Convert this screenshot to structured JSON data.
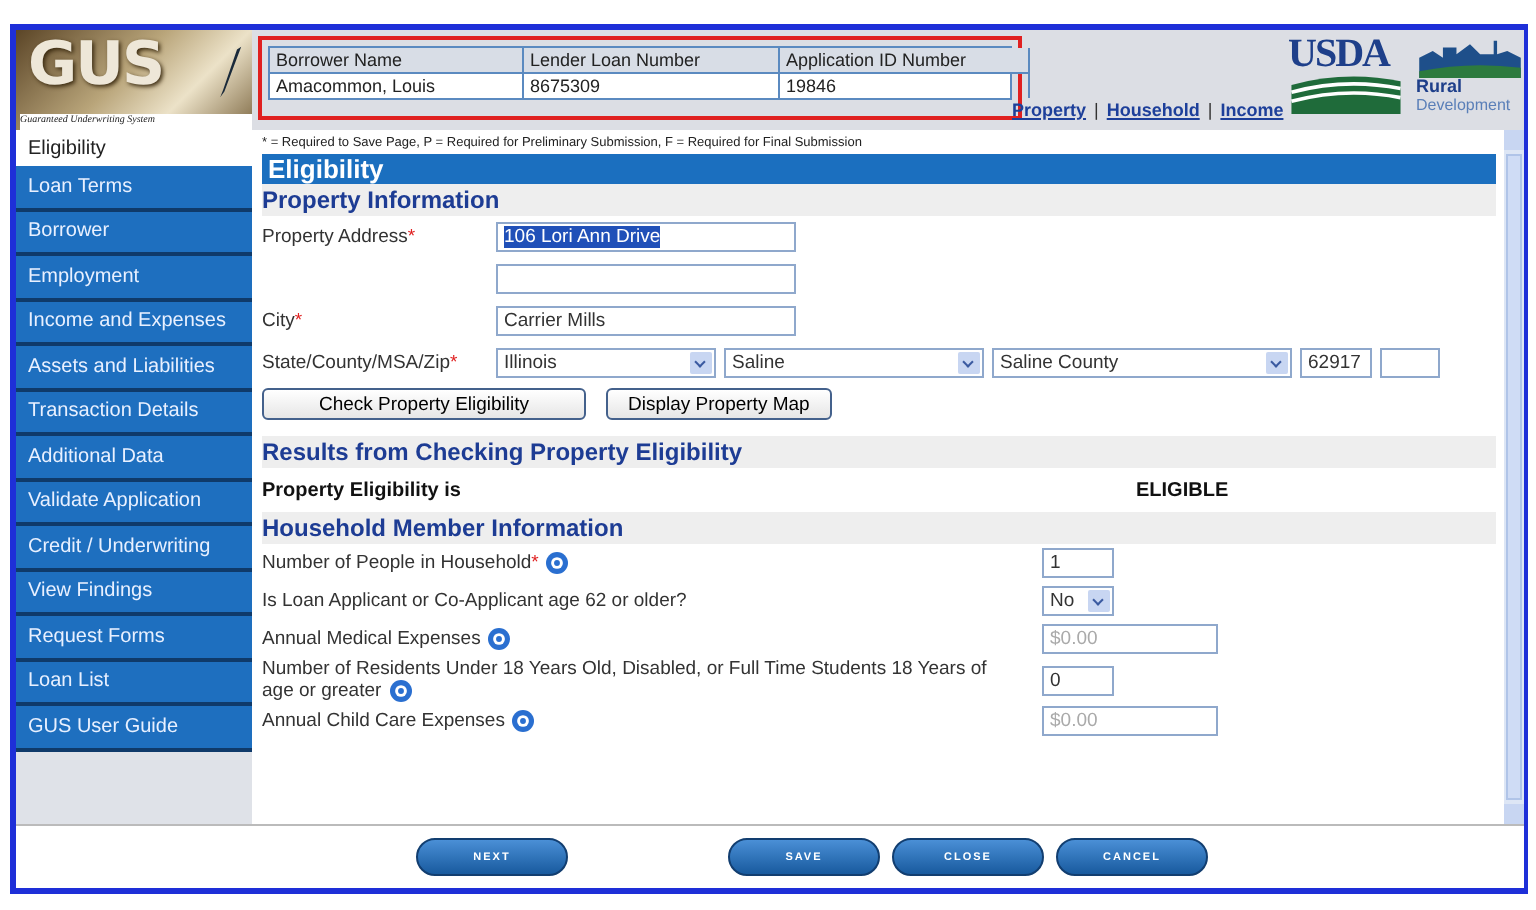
{
  "logo": {
    "title": "GUS",
    "subtitle": "Guaranteed Underwriting System"
  },
  "loan_summary": {
    "highlighted": true,
    "columns": [
      "Borrower Name",
      "Lender Loan Number",
      "Application ID Number"
    ],
    "values": [
      "Amacommon, Louis",
      "8675309",
      "19846"
    ]
  },
  "section_links": [
    "Property",
    "Household",
    "Income"
  ],
  "link_separator": "|",
  "required_mark": "*",
  "agency_logo": {
    "name": "USDA",
    "division_1": "Rural",
    "division_2": "Development"
  },
  "sidebar": {
    "items": [
      {
        "label": "Eligibility",
        "selected": true
      },
      {
        "label": "Loan Terms",
        "selected": false
      },
      {
        "label": "Borrower",
        "selected": false
      },
      {
        "label": "Employment",
        "selected": false
      },
      {
        "label": "Income and Expenses",
        "selected": false
      },
      {
        "label": "Assets and Liabilities",
        "selected": false
      },
      {
        "label": "Transaction Details",
        "selected": false
      },
      {
        "label": "Additional Data",
        "selected": false
      },
      {
        "label": "Validate Application",
        "selected": false
      },
      {
        "label": "Credit / Underwriting",
        "selected": false
      },
      {
        "label": "View Findings",
        "selected": false
      },
      {
        "label": "Request Forms",
        "selected": false
      },
      {
        "label": "Loan List",
        "selected": false
      },
      {
        "label": "GUS User Guide",
        "selected": false
      }
    ]
  },
  "legend": "* = Required to Save Page, P = Required for Preliminary Submission, F = Required for Final Submission",
  "page_title": "Eligibility",
  "property": {
    "heading": "Property Information",
    "address_label": "Property Address",
    "address_required": true,
    "address_line_1": "106 Lori Ann Drive",
    "address_line_1_selected": true,
    "city_label": "City",
    "city_required": true,
    "city": "Carrier Mills",
    "location_label": "State/County/MSA/Zip",
    "location_required": true,
    "state": "Illinois",
    "county": "Saline",
    "msa": "Saline County",
    "zip": "62917",
    "buttons": [
      "Check Property Eligibility",
      "Display Property Map"
    ]
  },
  "results": {
    "heading": "Results from Checking Property Eligibility",
    "label": "Property Eligibility is",
    "value": "ELIGIBLE"
  },
  "household": {
    "heading": "Household Member Information",
    "rows": [
      {
        "kind": "text",
        "label": "Number of People in Household",
        "required": true,
        "help": true,
        "value": "1"
      },
      {
        "kind": "select",
        "label": "Is Loan Applicant or Co-Applicant age 62 or older?",
        "required": false,
        "help": false,
        "value": "No"
      },
      {
        "kind": "money",
        "label": "Annual Medical Expenses",
        "required": false,
        "help": true,
        "placeholder": "$0.00"
      },
      {
        "kind": "text",
        "label": "Number of Residents Under 18 Years Old, Disabled, or Full Time Students 18 Years of age or greater",
        "required": false,
        "help": true,
        "value": "0"
      },
      {
        "kind": "money",
        "label": "Annual Child Care Expenses",
        "required": false,
        "help": true,
        "placeholder": "$0.00"
      }
    ]
  },
  "footer_buttons": [
    "NEXT",
    "SAVE",
    "CLOSE",
    "CANCEL"
  ]
}
